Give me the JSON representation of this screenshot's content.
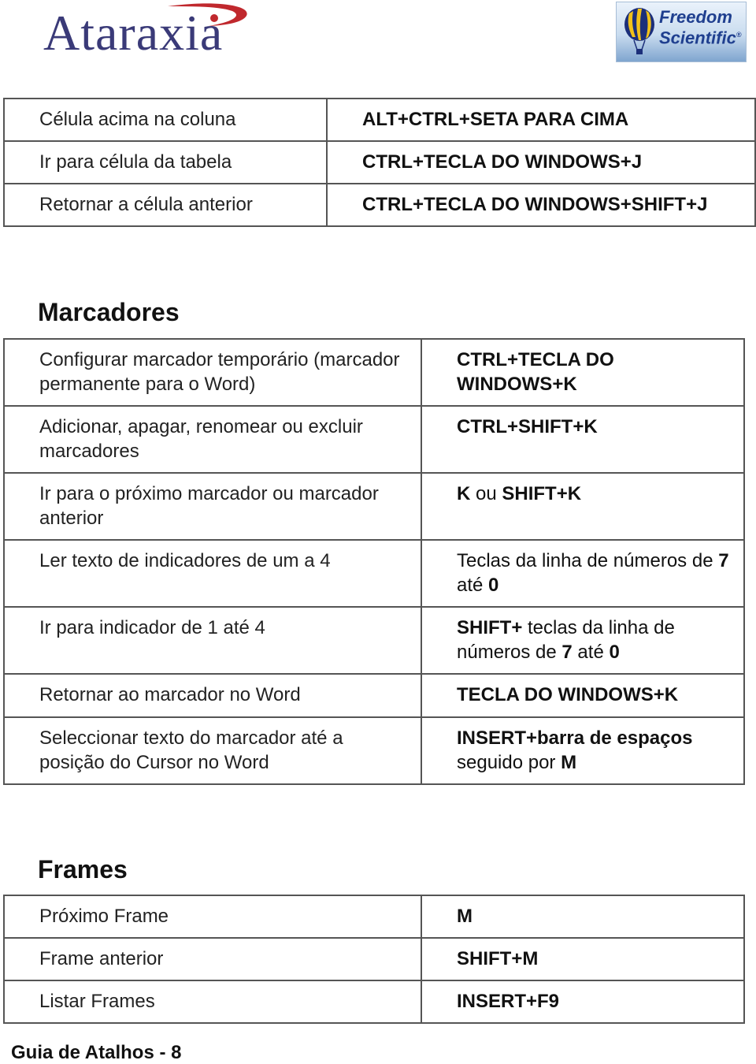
{
  "header": {
    "left_logo": {
      "name": "Ataraxia",
      "text": "Ataraxia",
      "color": "#3a3a78",
      "accent": "#c0282d"
    },
    "right_logo": {
      "name": "Freedom Scientific",
      "line1": "Freedom",
      "line2": "Scientific",
      "reg": "®",
      "color": "#1f3f8f",
      "balloon_colors": [
        "#f2c21a",
        "#1c2f7a"
      ]
    }
  },
  "table_top": {
    "rows": [
      {
        "action": "Célula acima na coluna",
        "keys": [
          {
            "t": "ALT+CTRL+SETA PARA CIMA",
            "b": true
          }
        ]
      },
      {
        "action": "Ir para célula da tabela",
        "keys": [
          {
            "t": "CTRL+TECLA DO WINDOWS+J",
            "b": true
          }
        ]
      },
      {
        "action": "Retornar a célula anterior",
        "keys": [
          {
            "t": "CTRL+TECLA DO WINDOWS+SHIFT+J",
            "b": true
          }
        ]
      }
    ]
  },
  "marcadores": {
    "title": "Marcadores",
    "rows": [
      {
        "action": "Configurar marcador temporário (marcador permanente para o Word)",
        "keys": [
          {
            "t": "CTRL+TECLA DO WINDOWS+K",
            "b": true
          }
        ]
      },
      {
        "action": "Adicionar, apagar, renomear ou excluir marcadores",
        "keys": [
          {
            "t": "CTRL+SHIFT+K",
            "b": true
          }
        ]
      },
      {
        "action": "Ir para o próximo marcador ou marcador anterior",
        "keys": [
          {
            "t": "K",
            "b": true
          },
          {
            "t": " ou ",
            "b": false
          },
          {
            "t": "SHIFT+K",
            "b": true
          }
        ]
      },
      {
        "action": "Ler texto de indicadores de um a 4",
        "keys": [
          {
            "t": "Teclas da linha de números de ",
            "b": false
          },
          {
            "t": "7",
            "b": true
          },
          {
            "t": " até ",
            "b": false
          },
          {
            "t": "0",
            "b": true
          }
        ]
      },
      {
        "action": "Ir para indicador de 1 até 4",
        "keys": [
          {
            "t": "SHIFT+",
            "b": true
          },
          {
            "t": " teclas da linha de números de ",
            "b": false
          },
          {
            "t": "7",
            "b": true
          },
          {
            "t": " até ",
            "b": false
          },
          {
            "t": "0",
            "b": true
          }
        ]
      },
      {
        "action": "Retornar ao marcador no Word",
        "keys": [
          {
            "t": "TECLA DO WINDOWS+K",
            "b": true
          }
        ]
      },
      {
        "action": "Seleccionar texto do marcador até a posição do Cursor no Word",
        "keys": [
          {
            "t": "INSERT+barra de espaços",
            "b": true
          },
          {
            "t": " seguido por ",
            "b": false
          },
          {
            "t": "M",
            "b": true
          }
        ]
      }
    ]
  },
  "frames": {
    "title": "Frames",
    "rows": [
      {
        "action": "Próximo Frame",
        "keys": [
          {
            "t": "M",
            "b": true
          }
        ]
      },
      {
        "action": "Frame anterior",
        "keys": [
          {
            "t": "SHIFT+M",
            "b": true
          }
        ]
      },
      {
        "action": "Listar Frames",
        "keys": [
          {
            "t": "INSERT+F9",
            "b": true
          }
        ]
      }
    ]
  },
  "footer": {
    "text": "Guia de Atalhos - 8"
  }
}
